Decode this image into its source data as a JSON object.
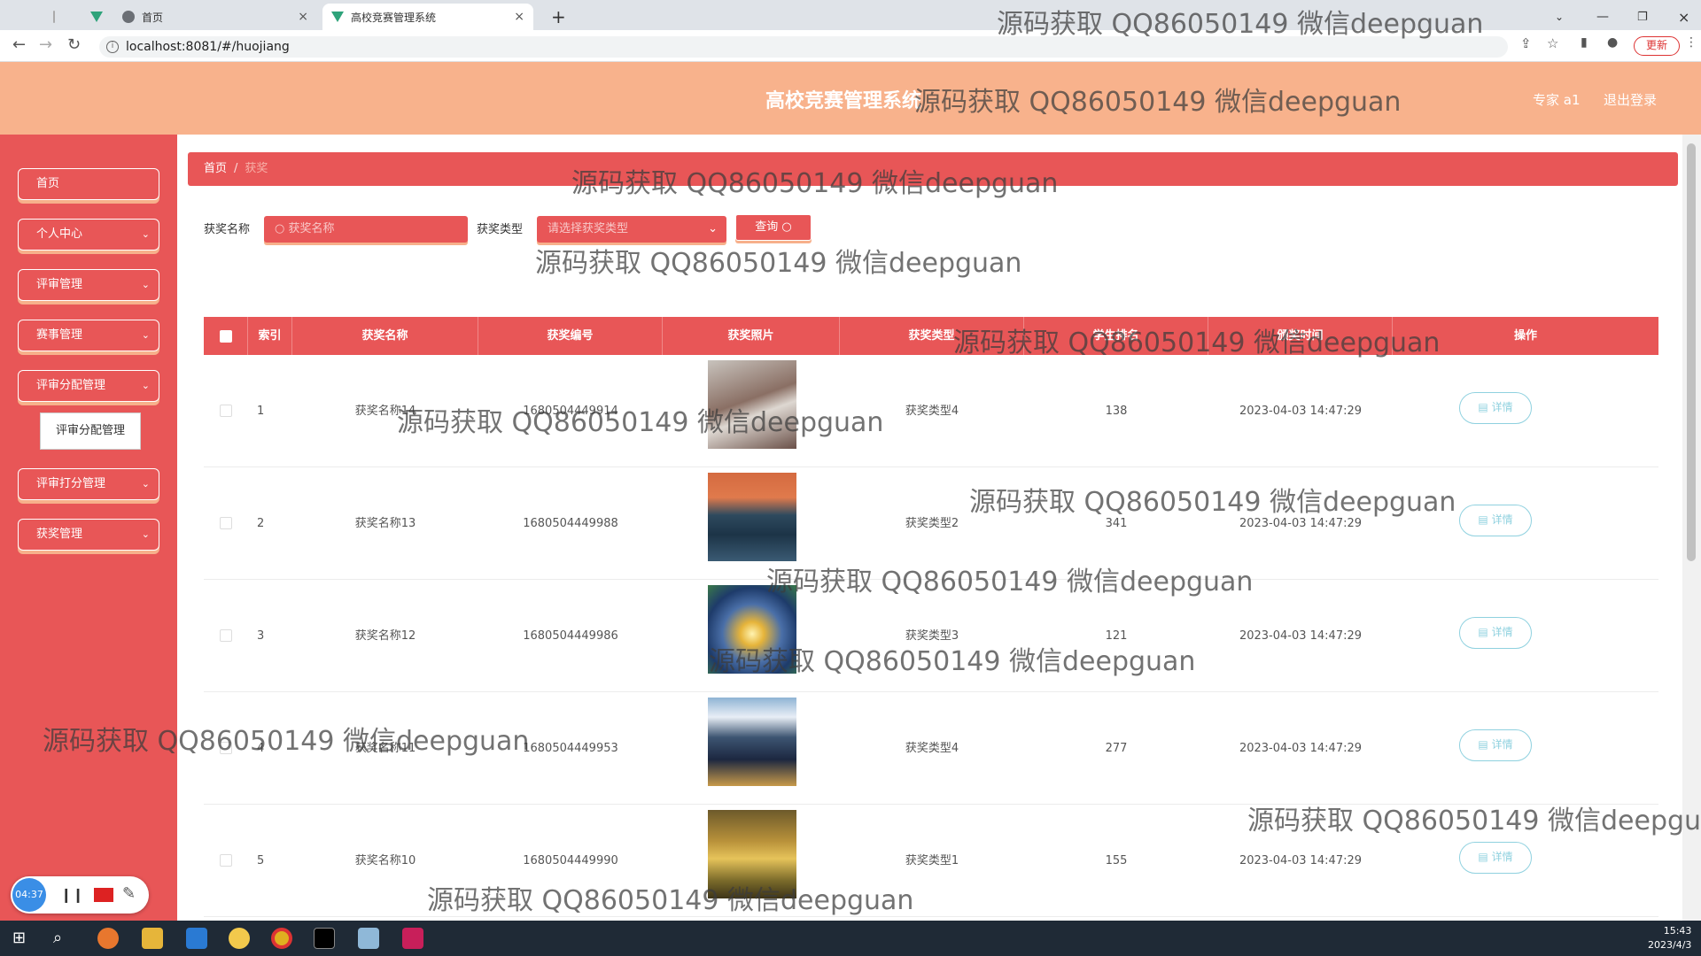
{
  "browser": {
    "tabs": [
      {
        "label": "首页"
      },
      {
        "label": "高校竞赛管理系统"
      }
    ],
    "url": "localhost:8081/#/huojiang",
    "update_label": "更新"
  },
  "header": {
    "title": "高校竞赛管理系统",
    "user": "专家 a1",
    "logout": "退出登录"
  },
  "sidebar": {
    "items": [
      {
        "label": "首页",
        "has_submenu": false
      },
      {
        "label": "个人中心",
        "has_submenu": true
      },
      {
        "label": "评审管理",
        "has_submenu": true
      },
      {
        "label": "赛事管理",
        "has_submenu": true
      },
      {
        "label": "评审分配管理",
        "has_submenu": true
      },
      {
        "label": "评审打分管理",
        "has_submenu": true
      },
      {
        "label": "获奖管理",
        "has_submenu": true
      }
    ],
    "open_submenu": "评审分配管理"
  },
  "breadcrumb": {
    "home": "首页",
    "sep": "/",
    "current": "获奖"
  },
  "filter": {
    "name_label": "获奖名称",
    "name_placeholder": "获奖名称",
    "type_label": "获奖类型",
    "type_placeholder": "请选择获奖类型",
    "query_label": "查询"
  },
  "table": {
    "columns": [
      "索引",
      "获奖名称",
      "获奖编号",
      "获奖照片",
      "获奖类型",
      "学生排名",
      "颁奖时间",
      "操作"
    ],
    "detail_label": "详情",
    "rows": [
      {
        "index": "1",
        "name": "获奖名称14",
        "code": "1680504449914",
        "type": "获奖类型4",
        "rank": "138",
        "time": "2023-04-03 14:47:29",
        "photo": "tree"
      },
      {
        "index": "2",
        "name": "获奖名称13",
        "code": "1680504449988",
        "type": "获奖类型2",
        "rank": "341",
        "time": "2023-04-03 14:47:29",
        "photo": "lake"
      },
      {
        "index": "3",
        "name": "获奖名称12",
        "code": "1680504449986",
        "type": "获奖类型3",
        "rank": "121",
        "time": "2023-04-03 14:47:29",
        "photo": "sunset"
      },
      {
        "index": "4",
        "name": "获奖名称11",
        "code": "1680504449953",
        "type": "获奖类型4",
        "rank": "277",
        "time": "2023-04-03 14:47:29",
        "photo": "city"
      },
      {
        "index": "5",
        "name": "获奖名称10",
        "code": "1680504449990",
        "type": "获奖类型1",
        "rank": "155",
        "time": "2023-04-03 14:47:29",
        "photo": "field"
      }
    ]
  },
  "recorder": {
    "time": "04:37"
  },
  "taskbar": {
    "time": "15:43",
    "date": "2023/4/3"
  },
  "watermark": "源码获取 QQ86050149 微信deepguan",
  "colors": {
    "primary": "#e85657",
    "header": "#f8b28c",
    "accent_shadow": "#f7b08b",
    "detail": "#8fd1df"
  }
}
